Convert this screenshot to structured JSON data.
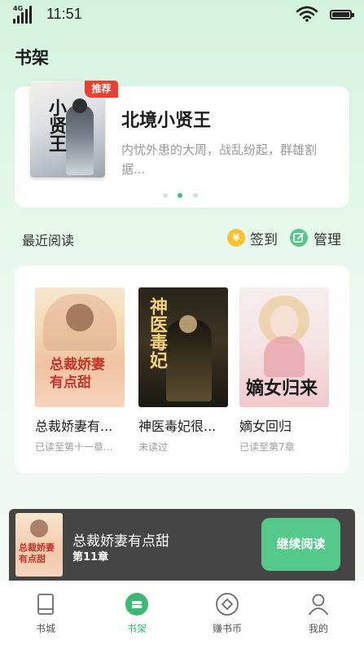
{
  "status_bar": {
    "network": "4G",
    "time": "11:51"
  },
  "page_title": "书架",
  "banner": {
    "badge": "推荐",
    "title": "北境小贤王",
    "description": "内忧外患的大周，战乱纷起，群雄割据...",
    "cover_text": "小贤王",
    "dots": 3,
    "active_dot": 1
  },
  "recent": {
    "title": "最近阅读",
    "sign_in_label": "签到",
    "sign_in_icon": "¥",
    "manage_label": "管理",
    "books": [
      {
        "name": "总裁娇妻有...",
        "progress": "已读至第十一章...",
        "cover_text": "总裁娇妻有点甜"
      },
      {
        "name": "神医毒妃很...",
        "progress": "未读过",
        "cover_text": "神医毒妃"
      },
      {
        "name": "嫡女回归",
        "progress": "已读至第7章",
        "cover_text": "嫡女归来"
      }
    ]
  },
  "reading_bar": {
    "title": "总裁娇妻有点甜",
    "chapter": "第11章",
    "continue_label": "继续阅读",
    "cover_text": "总裁娇妻有点甜"
  },
  "tabs": [
    {
      "label": "书城",
      "icon": "book-icon"
    },
    {
      "label": "书架",
      "icon": "bookshelf-icon",
      "active": true
    },
    {
      "label": "赚书币",
      "icon": "coin-icon"
    },
    {
      "label": "我的",
      "icon": "user-icon"
    }
  ],
  "colors": {
    "accent": "#55c98a",
    "badge": "#e8412f",
    "coin": "#f8c234"
  }
}
